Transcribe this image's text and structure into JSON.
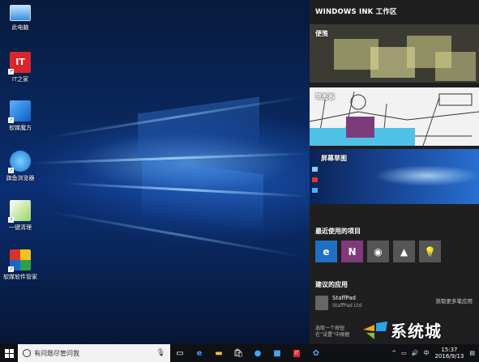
{
  "desktop": {
    "icons": [
      {
        "label": "此电脑",
        "icon": "computer-icon"
      },
      {
        "label": "IT之家",
        "icon": "ithome-icon"
      },
      {
        "label": "软媒魔方",
        "icon": "rubik-icon"
      },
      {
        "label": "旗鱼浏览器",
        "icon": "bird-icon"
      },
      {
        "label": "一键清理",
        "icon": "broom-icon"
      },
      {
        "label": "软媒软件管家",
        "icon": "manager-icon"
      }
    ]
  },
  "ink_workspace": {
    "title": "WINDOWS INK 工作区",
    "tiles": [
      {
        "label": "便笺"
      },
      {
        "label": "草图板"
      },
      {
        "label": "屏幕草图"
      }
    ],
    "recent_label": "最近使用的项目",
    "recent_apps": [
      {
        "icon": "edge-icon",
        "color": "#1f6fc4"
      },
      {
        "icon": "onenote-icon",
        "color": "#80397b"
      },
      {
        "icon": "webcam-icon",
        "color": "#555555"
      },
      {
        "icon": "photos-icon",
        "color": "#555555"
      },
      {
        "icon": "tips-icon",
        "color": "#555555"
      }
    ],
    "suggested_label": "建议的应用",
    "suggested_app": {
      "name": "StaffPad",
      "publisher": "StaffPad Ltd",
      "action": "获取更多笔应用"
    },
    "tip_lines": [
      "选取一个按钮",
      "在“设置”中根据"
    ]
  },
  "taskbar": {
    "search_placeholder": "有问题尽管问我",
    "clock_time": "15:37",
    "clock_date": "2016/9/13"
  },
  "watermark": {
    "text": "系统城"
  }
}
